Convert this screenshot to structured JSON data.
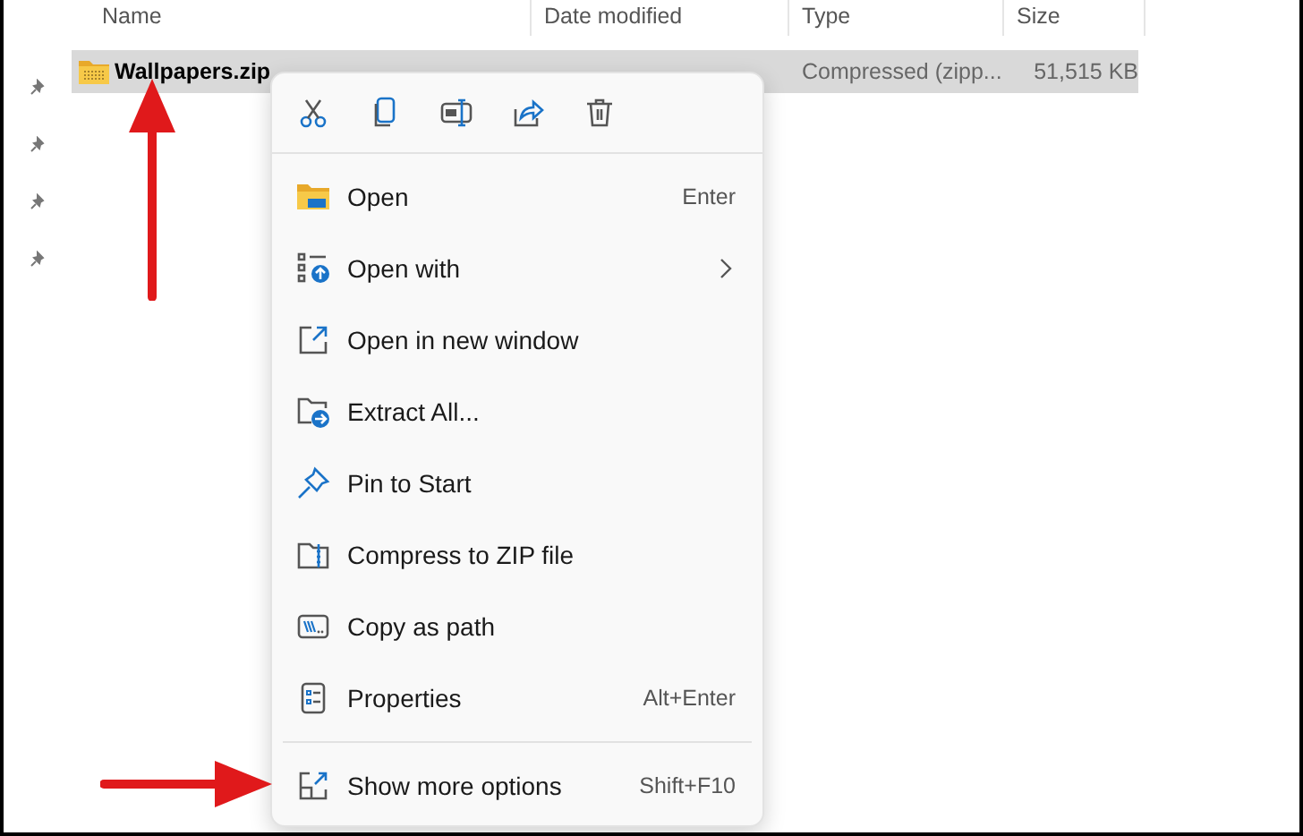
{
  "columns": [
    {
      "label": "Name"
    },
    {
      "label": "Date modified"
    },
    {
      "label": "Type"
    },
    {
      "label": "Size"
    }
  ],
  "rows": [
    {
      "name": "Wallpapers.zip",
      "type": "Compressed (zipp...",
      "size": "51,515 KB",
      "selected": true
    }
  ],
  "context_menu": {
    "toolbar": [
      {
        "kind": "cut"
      },
      {
        "kind": "copy"
      },
      {
        "kind": "rename"
      },
      {
        "kind": "share"
      },
      {
        "kind": "delete"
      }
    ],
    "items": [
      {
        "kind": "open",
        "label": "Open",
        "shortcut": "Enter",
        "submenu": false
      },
      {
        "kind": "open-with",
        "label": "Open with",
        "submenu": true
      },
      {
        "kind": "new-window",
        "label": "Open in new window",
        "submenu": false
      },
      {
        "kind": "extract",
        "label": "Extract All...",
        "submenu": false
      },
      {
        "kind": "pin",
        "label": "Pin to Start",
        "submenu": false
      },
      {
        "kind": "compress",
        "label": "Compress to ZIP file",
        "submenu": false
      },
      {
        "kind": "path",
        "label": "Copy as path",
        "submenu": false
      },
      {
        "kind": "properties",
        "label": "Properties",
        "shortcut": "Alt+Enter",
        "submenu": false
      },
      {
        "kind": "more",
        "label": "Show more options",
        "shortcut": "Shift+F10",
        "submenu": false,
        "separator_before": true
      }
    ]
  },
  "annotations": [
    {
      "kind": "arrow-up"
    },
    {
      "kind": "arrow-right"
    }
  ]
}
